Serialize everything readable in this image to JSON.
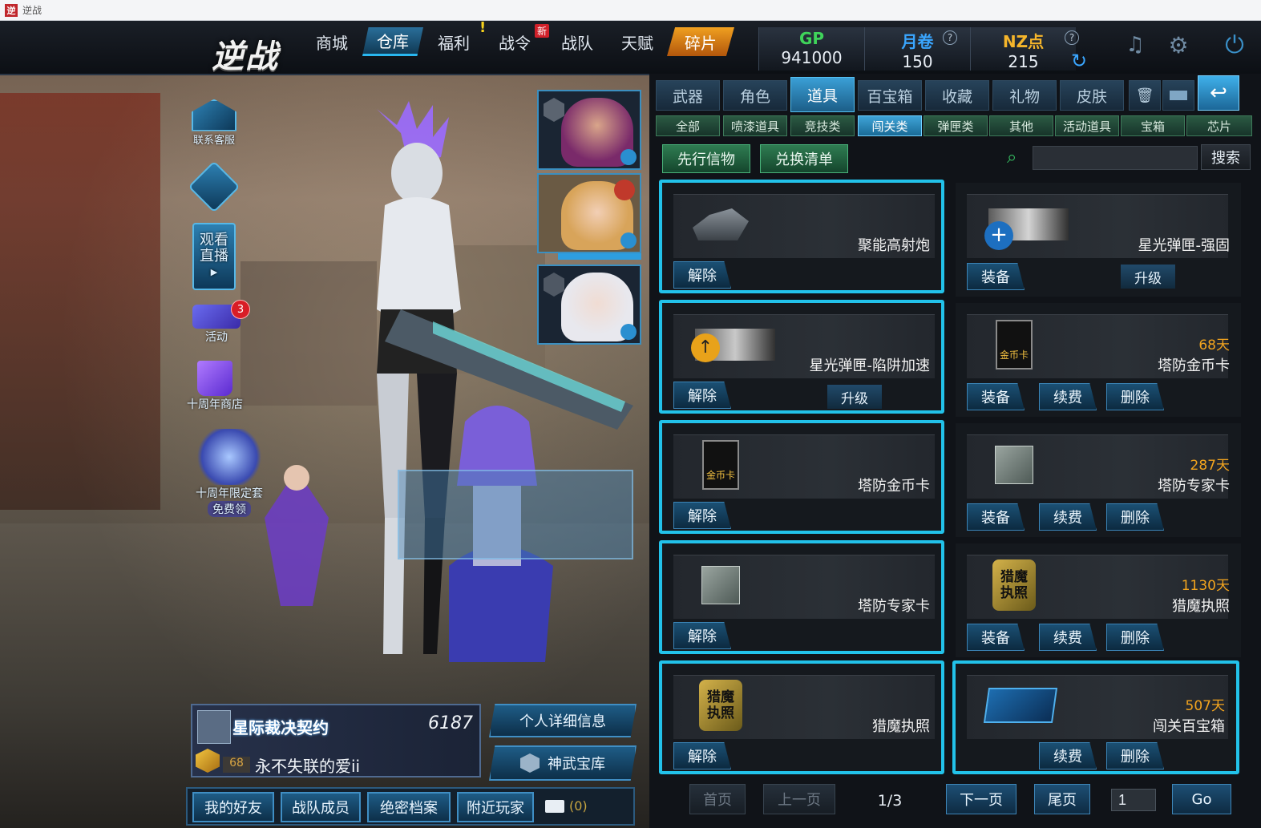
{
  "window": {
    "title": "逆战"
  },
  "logo": {
    "text": "逆战"
  },
  "nav": {
    "items": [
      "商城",
      "仓库",
      "福利",
      "战令",
      "战队",
      "天赋",
      "碎片"
    ],
    "new_badge": "新",
    "warn": "!"
  },
  "currency": {
    "gp_label": "GP",
    "gp_value": "941000",
    "coupon_label": "月卷",
    "coupon_value": "150",
    "nz_label": "NZ点",
    "nz_value": "215",
    "help": "?"
  },
  "sidebar": {
    "service_label": "联系客服",
    "live_label": "观看直播",
    "activity_label": "活动",
    "activity_count": "3",
    "shop_label": "十周年商店",
    "limited_label": "十周年限定套",
    "free_label": "免费领"
  },
  "player": {
    "title_card": "星际裁决契约",
    "card_number": "6187",
    "level": "68",
    "name": "永不失联的爱ii",
    "detail_button": "个人详细信息",
    "treasury_button": "神武宝库"
  },
  "bottom": {
    "friends": "我的好友",
    "team": "战队成员",
    "archive": "绝密档案",
    "nearby": "附近玩家",
    "mail_count": "(0)"
  },
  "tabs_main": [
    "武器",
    "角色",
    "道具",
    "百宝箱",
    "收藏",
    "礼物",
    "皮肤"
  ],
  "tabs_sub": [
    "全部",
    "喷漆道具",
    "竞技类",
    "闯关类",
    "弹匣类",
    "其他",
    "活动道具",
    "宝箱",
    "芯片"
  ],
  "filters": {
    "preview": "先行信物",
    "exchange": "兑换清单",
    "search_button": "搜索",
    "search_value": ""
  },
  "items_left": [
    {
      "name": "聚能高射炮",
      "btn": "解除"
    },
    {
      "name": "星光弹匣-陷阱加速",
      "btn": "解除",
      "upgrade": "升级"
    },
    {
      "name": "塔防金币卡",
      "btn": "解除"
    },
    {
      "name": "塔防专家卡",
      "btn": "解除"
    },
    {
      "name": "猎魔执照",
      "btn": "解除"
    }
  ],
  "items_right": [
    {
      "name": "星光弹匣-强固",
      "days": "",
      "b1": "装备",
      "upgrade": "升级"
    },
    {
      "name": "塔防金币卡",
      "days": "68天",
      "b1": "装备",
      "b2": "续费",
      "b3": "删除"
    },
    {
      "name": "塔防专家卡",
      "days": "287天",
      "b1": "装备",
      "b2": "续费",
      "b3": "删除"
    },
    {
      "name": "猎魔执照",
      "days": "1130天",
      "b1": "装备",
      "b2": "续费",
      "b3": "删除"
    },
    {
      "name": "闯关百宝箱",
      "days": "507天",
      "b2": "续费",
      "b3": "删除"
    }
  ],
  "icon_text": {
    "coin_card": "金币卡",
    "hunt_license_a": "猎魔",
    "hunt_license_b": "执照"
  },
  "pager": {
    "first": "首页",
    "prev": "上一页",
    "page": "1/3",
    "next": "下一页",
    "last": "尾页",
    "input": "1",
    "go": "Go"
  },
  "colors": {
    "accent": "#22c2ea",
    "days": "#f2a41e",
    "gp": "#3fd35a",
    "coupon": "#3aa6ff",
    "nz": "#f5b52b"
  }
}
